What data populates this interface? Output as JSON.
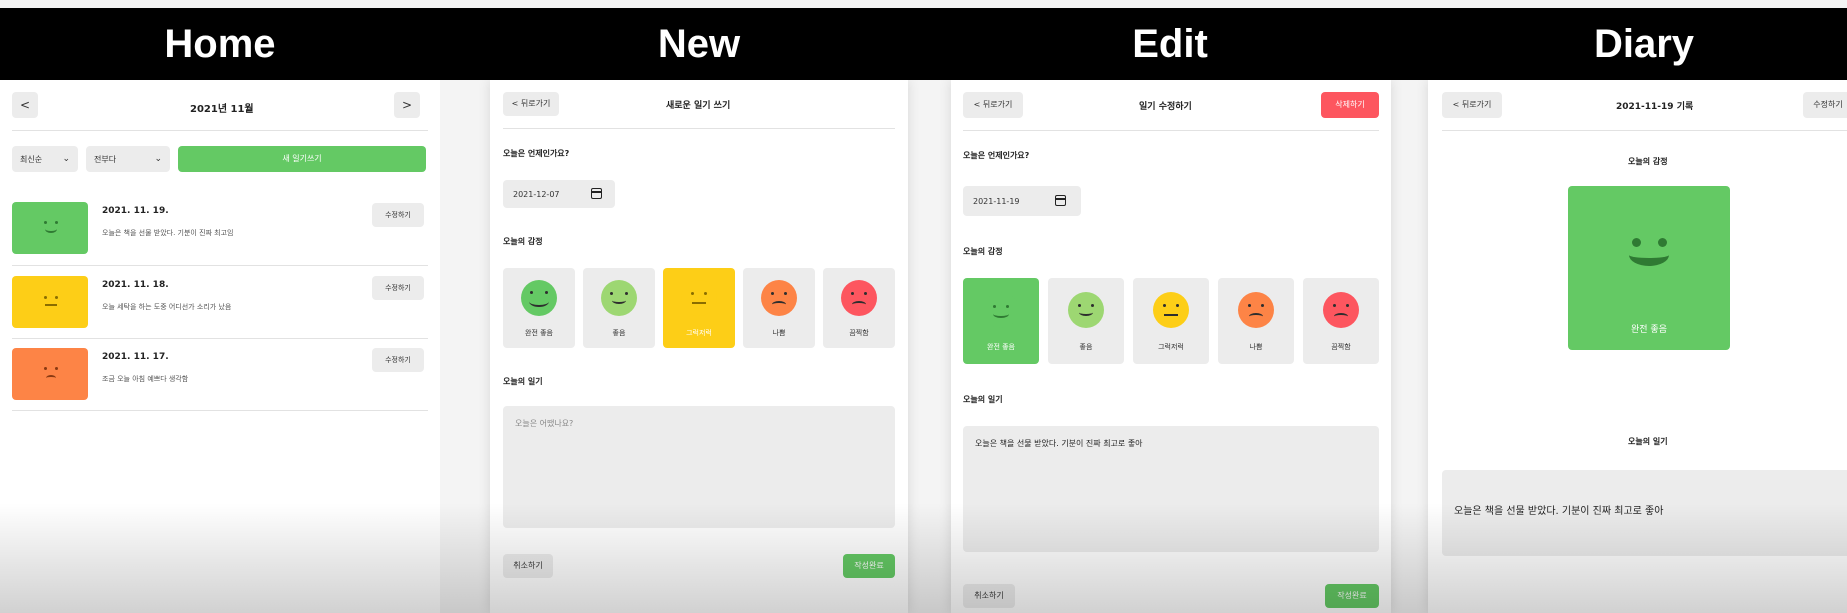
{
  "tabs": [
    "Home",
    "New",
    "Edit",
    "Diary"
  ],
  "home": {
    "prev": "<",
    "next": ">",
    "month": "2021년 11월",
    "sort_select": "최신순",
    "filter_select": "전부다",
    "new_button": "새 일기쓰기",
    "entries": [
      {
        "date": "2021. 11. 19.",
        "text": "오늘은 책을 선물 받았다. 기분이 진짜 최고임",
        "edit": "수정하기",
        "color": "#64c964",
        "mood": "good"
      },
      {
        "date": "2021. 11. 18.",
        "text": "오늘 세탁을 하는 도중 어디선가 소리가 났음",
        "edit": "수정하기",
        "color": "#fdce17",
        "mood": "normal"
      },
      {
        "date": "2021. 11. 17.",
        "text": "조금 오늘 아침 예쁘다 생각함",
        "edit": "수정하기",
        "color": "#fd8446",
        "mood": "bad"
      }
    ]
  },
  "new": {
    "back": "< 뒤로가기",
    "title": "새로운 일기 쓰기",
    "date_label": "오늘은 언제인가요?",
    "date_value": "2021-12-07",
    "emotion_label": "오늘의 감정",
    "emotions": [
      "완전 좋음",
      "좋음",
      "그럭저럭",
      "나쁨",
      "끔찍함"
    ],
    "diary_label": "오늘의 일기",
    "placeholder": "오늘은 어땠나요?",
    "cancel": "취소하기",
    "submit": "작성완료"
  },
  "edit": {
    "back": "< 뒤로가기",
    "title": "일기 수정하기",
    "delete": "삭제하기",
    "date_label": "오늘은 언제인가요?",
    "date_value": "2021-11-19",
    "emotion_label": "오늘의 감정",
    "emotions": [
      "완전 좋음",
      "좋음",
      "그럭저럭",
      "나쁨",
      "끔찍함"
    ],
    "diary_label": "오늘의 일기",
    "content": "오늘은 책을 선물 받았다. 기분이 진짜 최고로 좋아",
    "cancel": "취소하기",
    "submit": "작성완료"
  },
  "diary": {
    "back": "< 뒤로가기",
    "title": "2021-11-19 기록",
    "edit": "수정하기",
    "emotion_label": "오늘의 감정",
    "emotion_name": "완전 좋음",
    "diary_label": "오늘의 일기",
    "content": "오늘은 책을 선물 받았다. 기분이 진짜 최고로 좋아"
  },
  "colors": {
    "green": "#64c964",
    "lightgreen": "#9dd772",
    "yellow": "#fdce17",
    "orange": "#fd8446",
    "red": "#fd565f",
    "gray": "#ececec"
  }
}
